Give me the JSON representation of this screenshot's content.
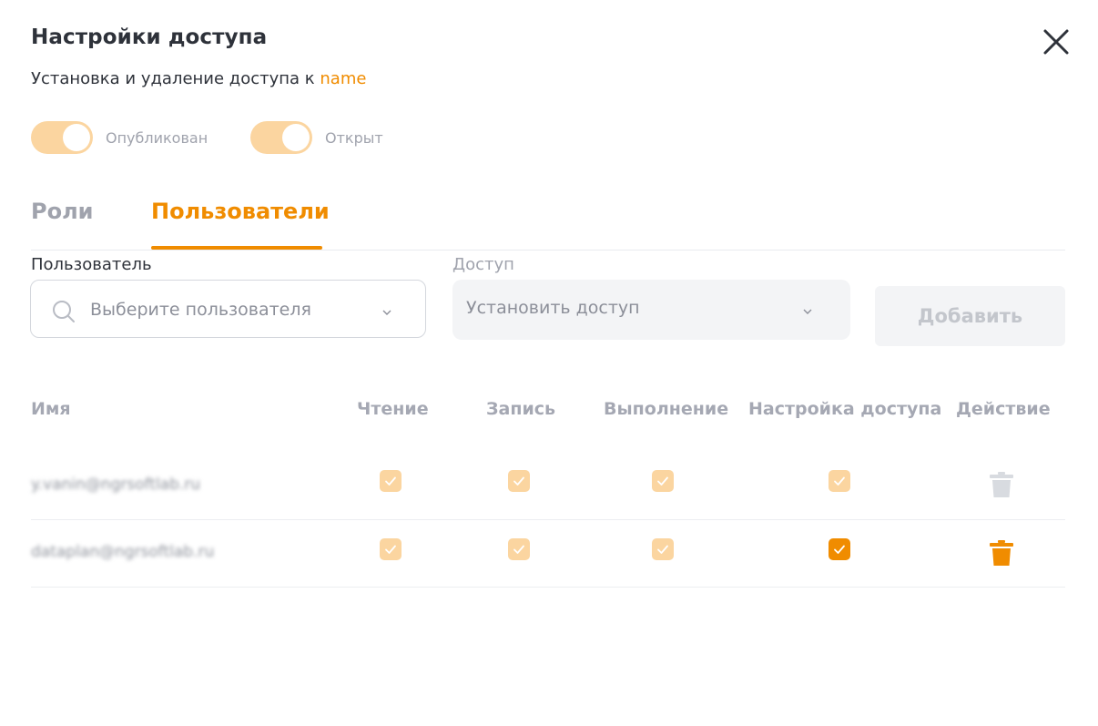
{
  "dialog": {
    "title": "Настройки доступа",
    "subtitle_prefix": "Установка и удаление доступа к ",
    "subtitle_name": "name",
    "close_icon": "close-icon"
  },
  "toggles": [
    {
      "label": "Опубликован",
      "on": true
    },
    {
      "label": "Открыт",
      "on": true
    }
  ],
  "tabs": [
    {
      "label": "Роли",
      "active": false
    },
    {
      "label": "Пользователи",
      "active": true
    }
  ],
  "form": {
    "user_label": "Пользователь",
    "user_placeholder": "Выберите пользователя",
    "access_label": "Доступ",
    "access_placeholder": "Установить доступ",
    "add_button": "Добавить"
  },
  "table": {
    "headers": [
      "Имя",
      "Чтение",
      "Запись",
      "Выполнение",
      "Настройка доступа",
      "Действие"
    ],
    "rows": [
      {
        "name": "y.vanin@ngrsoftlab.ru",
        "read": true,
        "write": true,
        "execute": true,
        "access": true,
        "access_editable": false,
        "delete_enabled": false
      },
      {
        "name": "dataplan@ngrsoftlab.ru",
        "read": true,
        "write": true,
        "execute": true,
        "access": true,
        "access_editable": true,
        "delete_enabled": true
      }
    ]
  },
  "colors": {
    "accent": "#f08c00",
    "accent_light": "#fbd5a0",
    "muted": "#a0a3ad",
    "trash_disabled": "#d8dbe0"
  }
}
